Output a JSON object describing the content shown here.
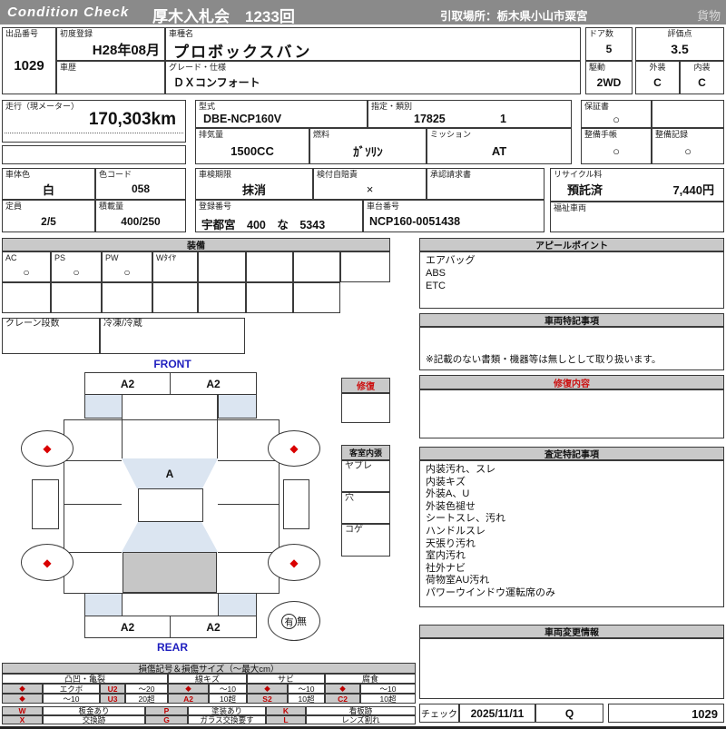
{
  "colors": {
    "header_bg": "#8a8a8a",
    "section_bg": "#c9c9c9",
    "highlight_blue": "#dbe5f1",
    "cargo_gray": "#c6c6c6",
    "mark_red": "#d90000",
    "label_blue": "#1f1fbf"
  },
  "header": {
    "brand": "Condition  Check",
    "title": "厚木入札会　1233回",
    "pickup": "引取場所：栃木県小山市粟宮",
    "category": "貨物"
  },
  "top": {
    "lot": {
      "label": "出品番号",
      "value": "1029"
    },
    "first_reg": {
      "label": "初度登録",
      "value": "H28年08月"
    },
    "history": {
      "label": "車歴",
      "value": ""
    },
    "model": {
      "label": "車種名",
      "value": "プロボックスバン"
    },
    "grade": {
      "label": "グレード・仕様",
      "value": "ＤＸコンフォート"
    },
    "doors": {
      "label": "ドア数",
      "value": "5"
    },
    "drive": {
      "label": "駆動",
      "value": "2WD"
    },
    "score": {
      "label": "評価点",
      "value": "3.5"
    },
    "exterior": {
      "label": "外装",
      "value": "C"
    },
    "interior": {
      "label": "内装",
      "value": "C"
    }
  },
  "mileage": {
    "label": "走行（現メーター）",
    "value": "170,303km"
  },
  "specs": {
    "model_code": {
      "label": "型式",
      "value": "DBE-NCP160V"
    },
    "class": {
      "label": "指定・類別",
      "value1": "17825",
      "value2": "1"
    },
    "displacement": {
      "label": "排気量",
      "value": "1500CC"
    },
    "fuel": {
      "label": "燃料",
      "value": "ｶﾞｿﾘﾝ"
    },
    "transmission": {
      "label": "ミッション",
      "value": "AT"
    },
    "warranty": {
      "label": "保証書",
      "value": "○"
    },
    "maintenance_book": {
      "label": "整備手帳",
      "value": "○"
    },
    "maintenance_record": {
      "label": "整備記録",
      "value": "○"
    }
  },
  "registration": {
    "body_color": {
      "label": "車体色",
      "value": "白"
    },
    "color_code": {
      "label": "色コード",
      "value": "058"
    },
    "capacity": {
      "label": "定員",
      "value": "2/5"
    },
    "load": {
      "label": "積載量",
      "value": "400/250"
    },
    "inspection": {
      "label": "車検期限",
      "value": "抹消"
    },
    "insurance": {
      "label": "検付自賠責",
      "value": "×"
    },
    "approval": {
      "label": "承認請求書",
      "value": ""
    },
    "reg_number": {
      "label": "登録番号",
      "value": "宇都宮　400　な　5343"
    },
    "chassis": {
      "label": "車台番号",
      "value": "NCP160-0051438"
    },
    "recycle": {
      "label": "リサイクル料",
      "status": "預託済",
      "fee": "7,440円"
    },
    "welfare": {
      "label": "福祉車両",
      "value": ""
    }
  },
  "equipment": {
    "title": "装備",
    "row1": [
      {
        "label": "AC",
        "value": "○"
      },
      {
        "label": "PS",
        "value": "○"
      },
      {
        "label": "PW",
        "value": "○"
      },
      {
        "label": "Wﾀｲﾔ",
        "value": ""
      },
      {
        "label": "",
        "value": ""
      },
      {
        "label": "",
        "value": ""
      },
      {
        "label": "",
        "value": ""
      },
      {
        "label": "",
        "value": ""
      }
    ],
    "crane": {
      "label": "クレーン段数",
      "value": ""
    },
    "fridge": {
      "label": "冷凍/冷蔵",
      "value": ""
    }
  },
  "appeal": {
    "title": "アピールポイント",
    "items": [
      "エアバッグ",
      "ABS",
      "ETC"
    ]
  },
  "vehicle_notes": {
    "title": "車両特記事項",
    "note": "※記載のない書類・機器等は無しとして取り扱います。"
  },
  "repair_detail": {
    "title": "修復内容",
    "content": ""
  },
  "appraisal": {
    "title": "査定特記事項",
    "items": [
      "内装汚れ、スレ",
      "内装キズ",
      "外装A、U",
      "外装色褪せ",
      "シートスレ、汚れ",
      "ハンドルスレ",
      "天張り汚れ",
      "室内汚れ",
      "社外ナビ",
      "荷物室AU汚れ",
      "パワーウインドウ運転席のみ"
    ]
  },
  "change_info": {
    "title": "車両変更情報",
    "content": ""
  },
  "check": {
    "label": "チェック",
    "date": "2025/11/11",
    "inspector": "Q",
    "lot": "1029"
  },
  "diagram": {
    "front": "FRONT",
    "rear": "REAR",
    "bumper_code": "A2",
    "glass_code": "A",
    "mark": "◆",
    "repair": {
      "title": "修復"
    },
    "cabin": {
      "title": "客室内張",
      "rows": [
        "ヤブレ",
        "穴",
        "コゲ"
      ]
    },
    "spare": {
      "yes": "有",
      "no": "無"
    }
  },
  "legend": {
    "title": "損傷記号＆損傷サイズ（～最大cm）",
    "groups": [
      "凸凹・亀裂",
      "線キズ",
      "サビ",
      "腐食"
    ],
    "r1": [
      "◆",
      "エクボ",
      "U2",
      "～20",
      "◆",
      "～10",
      "◆",
      "～10",
      "◆",
      "～10"
    ],
    "r2": [
      "◆",
      "～10",
      "U3",
      "20超",
      "A2",
      "10超",
      "S2",
      "10超",
      "C2",
      "10超"
    ],
    "codes_r1": [
      {
        "code": "W",
        "desc": "板金あり"
      },
      {
        "code": "P",
        "desc": "塗装あり"
      },
      {
        "code": "K",
        "desc": "看板跡"
      }
    ],
    "codes_r2": [
      {
        "code": "X",
        "desc": "交換跡"
      },
      {
        "code": "G",
        "desc": "ガラス交換要す"
      },
      {
        "code": "L",
        "desc": "レンズ割れ"
      }
    ]
  }
}
